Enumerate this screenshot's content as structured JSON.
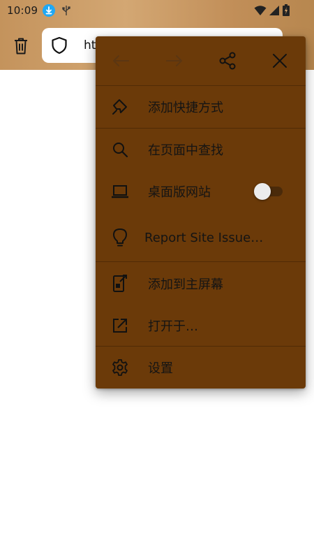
{
  "status_bar": {
    "time": "10:09",
    "icons": [
      "download-icon",
      "usb-icon",
      "wifi-icon",
      "signal-icon",
      "battery-icon"
    ]
  },
  "toolbar": {
    "url_text": "ht",
    "icons": [
      "trash-icon",
      "shield-icon"
    ]
  },
  "menu": {
    "top_icons": [
      "back-arrow-icon",
      "forward-arrow-icon",
      "share-icon",
      "close-icon"
    ],
    "items": [
      {
        "label": "添加快捷方式",
        "icon": "pin-icon"
      },
      {
        "label": "在页面中查找",
        "icon": "search-icon"
      },
      {
        "label": "桌面版网站",
        "icon": "laptop-icon",
        "toggle_on": false
      },
      {
        "label": "Report Site Issue…",
        "icon": "lightbulb-icon"
      },
      {
        "label": "添加到主屏幕",
        "icon": "add-to-homescreen-icon"
      },
      {
        "label": "打开于…",
        "icon": "open-external-icon"
      },
      {
        "label": "设置",
        "icon": "gear-icon"
      }
    ]
  },
  "colors": {
    "header_gradient_start": "#c4935c",
    "header_gradient_end": "#b7874f",
    "menu_background": "#6b3a09",
    "download_badge": "#1fa8f4"
  }
}
